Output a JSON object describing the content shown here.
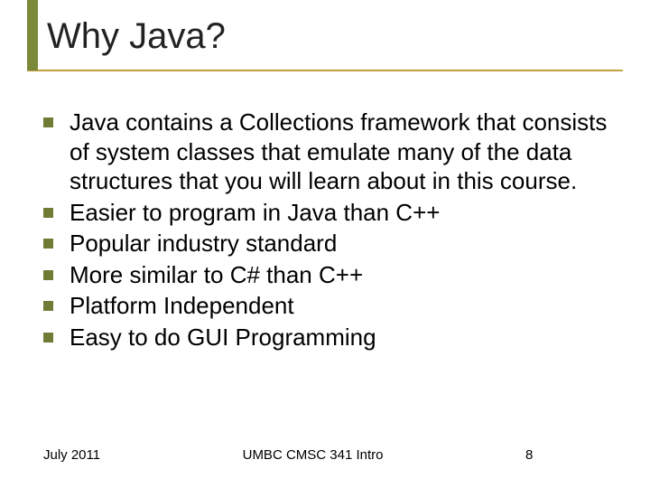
{
  "title": "Why Java?",
  "bullets": [
    "Java contains a Collections framework that consists of system classes that emulate many of the data structures that you will learn about in this course.",
    "Easier to program in Java than C++",
    "Popular industry standard",
    "More similar to C# than C++",
    "Platform Independent",
    "Easy to do GUI Programming"
  ],
  "footer": {
    "date": "July 2011",
    "center": "UMBC CMSC 341 Intro",
    "page": "8"
  }
}
